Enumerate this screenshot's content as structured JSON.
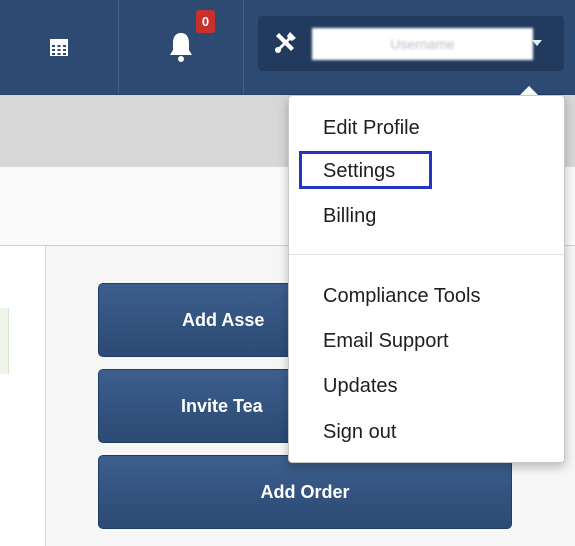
{
  "topbar": {
    "notification_count": "0",
    "user_name": "Username"
  },
  "actions": {
    "add_asset": "Add Asse",
    "invite_team": "Invite Tea",
    "add_order": "Add Order"
  },
  "dropdown": {
    "items": [
      "Edit Profile",
      "Settings",
      "Billing",
      "Compliance Tools",
      "Email Support",
      "Updates",
      "Sign out"
    ]
  },
  "colors": {
    "navbar": "#2d4a73",
    "user_button": "#213a5e",
    "badge": "#c9302c",
    "action_button": "#2f4f7a",
    "highlight": "#2434c5"
  },
  "icons": {
    "calendar": "calendar-icon",
    "bell": "bell-icon",
    "wrench": "tools-icon",
    "caret": "caret-down-icon"
  }
}
